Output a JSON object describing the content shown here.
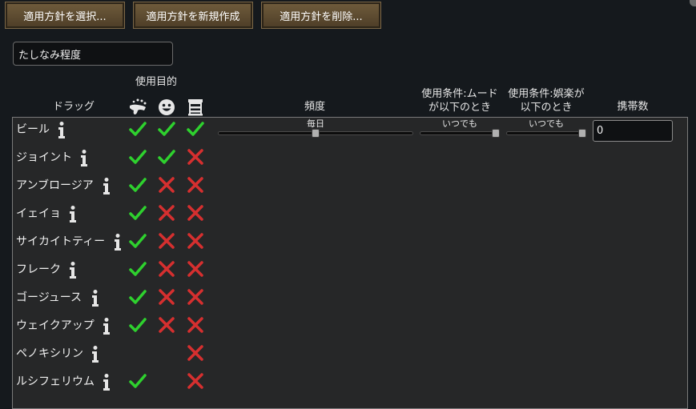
{
  "toolbar": {
    "select_label": "適用方針を選択...",
    "new_label": "適用方針を新規作成",
    "delete_label": "適用方針を削除..."
  },
  "policy_name": "たしなみ程度",
  "headers": {
    "purpose": "使用目的",
    "drug": "ドラッグ",
    "frequency": "頻度",
    "mood_line1": "使用条件:ムード",
    "mood_line2": "が以下のとき",
    "joy_line1": "使用条件:娯楽が",
    "joy_line2": "以下のとき",
    "carry": "携帯数"
  },
  "purpose_icons": [
    "high-icon",
    "joy-icon",
    "addiction-icon"
  ],
  "first_row_settings": {
    "frequency": {
      "label": "毎日",
      "level": 0.5
    },
    "mood": {
      "label": "いつでも",
      "level": 1.0
    },
    "joy": {
      "label": "いつでも",
      "level": 1.0
    },
    "carry_value": "0"
  },
  "drugs": [
    {
      "name": "ビール",
      "marks": [
        "check",
        "check",
        "check"
      ]
    },
    {
      "name": "ジョイント",
      "marks": [
        "check",
        "check",
        "cross"
      ]
    },
    {
      "name": "アンブロージア",
      "marks": [
        "check",
        "cross",
        "cross"
      ]
    },
    {
      "name": "イェイョ",
      "marks": [
        "check",
        "cross",
        "cross"
      ]
    },
    {
      "name": "サイカイトティー",
      "marks": [
        "check",
        "cross",
        "cross"
      ]
    },
    {
      "name": "フレーク",
      "marks": [
        "check",
        "cross",
        "cross"
      ]
    },
    {
      "name": "ゴージュース",
      "marks": [
        "check",
        "cross",
        "cross"
      ]
    },
    {
      "name": "ウェイクアップ",
      "marks": [
        "check",
        "cross",
        "cross"
      ]
    },
    {
      "name": "ペノキシリン",
      "marks": [
        "none",
        "none",
        "cross"
      ]
    },
    {
      "name": "ルシフェリウム",
      "marks": [
        "check",
        "none",
        "cross"
      ]
    }
  ],
  "colors": {
    "check": "#2ed12e",
    "cross": "#d62f2f"
  }
}
